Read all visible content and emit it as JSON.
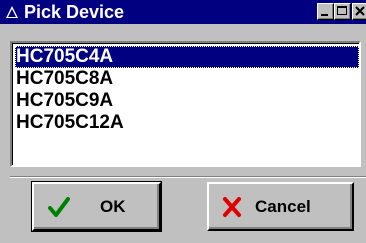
{
  "window": {
    "title": "Pick Device",
    "title_icon": "app-icon",
    "controls": [
      "minimize-icon",
      "maximize-icon",
      "close-icon"
    ]
  },
  "device_list": {
    "items": [
      "HC705C4A",
      "HC705C8A",
      "HC705C9A",
      "HC705C12A"
    ],
    "selected_index": 0
  },
  "buttons": {
    "ok": {
      "label": "OK",
      "icon": "checkmark-icon"
    },
    "cancel": {
      "label": "Cancel",
      "icon": "x-icon"
    }
  },
  "colors": {
    "titlebar": "#000080",
    "selection": "#000080",
    "face": "#c0c0c0",
    "checkmark": "#008000",
    "cancel_x": "#ff0000"
  }
}
